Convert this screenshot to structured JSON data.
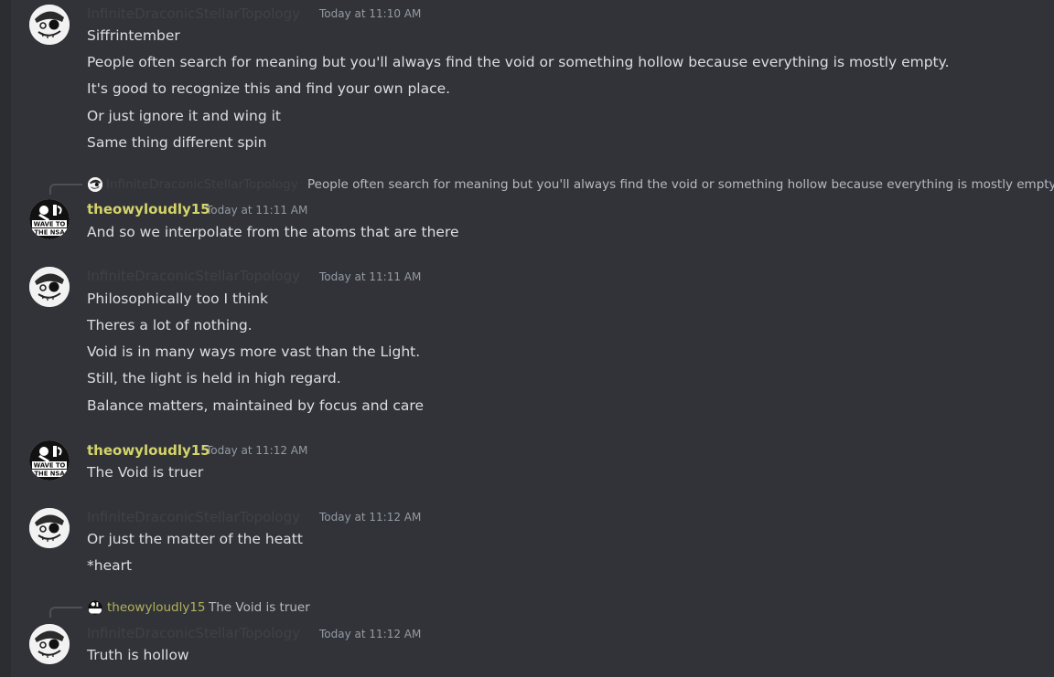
{
  "colors": {
    "background": "#313338",
    "username_dim": "#3f4147",
    "username_olive": "#d4d46a",
    "timestamp": "#949ba4",
    "message_text": "#dbdee1"
  },
  "messages": [
    {
      "author": "InfiniteDraconicStellarTopology",
      "timestamp": "Today at 11:10 AM",
      "avatar": "skull-cap-avatar",
      "lines": [
        "Siffrintember",
        "People often search for meaning but you'll always find the void or something hollow because everything is mostly empty.",
        "It's good to recognize this and find your own place.",
        "Or just ignore it and wing it",
        "Same thing different spin"
      ]
    },
    {
      "reply": {
        "author": "InfiniteDraconicStellarTopology",
        "text": "People often search for meaning but you'll always find the void or something hollow because everything is mostly empty."
      },
      "author": "theowyloudly15",
      "timestamp": "Today at 11:11 AM",
      "avatar": "wave-to-the-nsa-avatar",
      "avatar_text": [
        "WAVE TO",
        "THE NSA"
      ],
      "lines": [
        "And so we interpolate from the atoms that are there"
      ]
    },
    {
      "author": "InfiniteDraconicStellarTopology",
      "timestamp": "Today at 11:11 AM",
      "avatar": "skull-cap-avatar",
      "lines": [
        "Philosophically too I think",
        "Theres a lot of nothing.",
        "Void is in many ways more vast than the Light.",
        "Still, the light is held in high regard.",
        "Balance matters, maintained by focus and care"
      ]
    },
    {
      "author": "theowyloudly15",
      "timestamp": "Today at 11:12 AM",
      "avatar": "wave-to-the-nsa-avatar",
      "avatar_text": [
        "WAVE TO",
        "THE NSA"
      ],
      "lines": [
        "The Void is truer"
      ]
    },
    {
      "author": "InfiniteDraconicStellarTopology",
      "timestamp": "Today at 11:12 AM",
      "avatar": "skull-cap-avatar",
      "lines": [
        "Or just the matter of the heatt",
        "*heart"
      ]
    },
    {
      "reply": {
        "author": "theowyloudly15",
        "text": "The Void is truer"
      },
      "author": "InfiniteDraconicStellarTopology",
      "timestamp": "Today at 11:12 AM",
      "avatar": "skull-cap-avatar",
      "lines": [
        "Truth is hollow"
      ]
    }
  ]
}
